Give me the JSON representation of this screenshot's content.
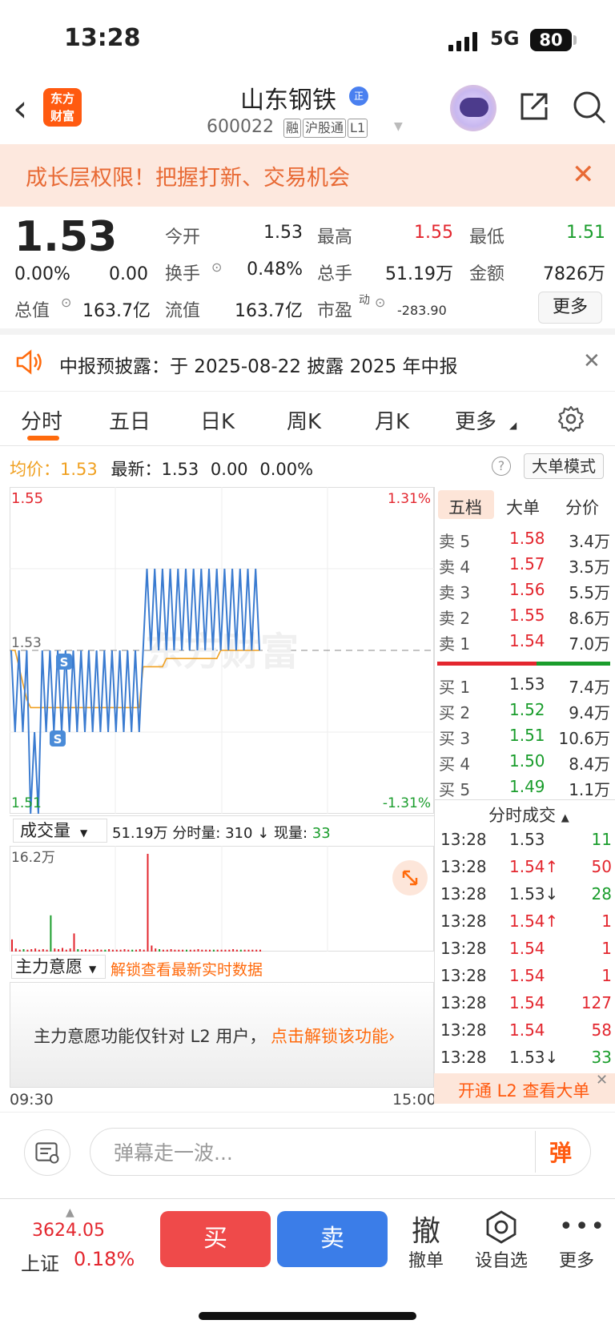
{
  "status_bar": {
    "time": "13:28",
    "network": "5G",
    "battery": "80"
  },
  "header": {
    "logo_text": "东方财富",
    "stock_name": "山东钢铁",
    "badge": "正",
    "stock_code": "600022",
    "tags": [
      "融",
      "沪股通",
      "L1"
    ]
  },
  "promo": {
    "text": "成长层权限！把握打新、交易机会"
  },
  "quote": {
    "price": "1.53",
    "change_pct": "0.00%",
    "change_val": "0.00",
    "open_label": "今开",
    "open": "1.53",
    "high_label": "最高",
    "high": "1.55",
    "low_label": "最低",
    "low": "1.51",
    "turnover_label": "换手",
    "turnover": "0.48%",
    "volume_label": "总手",
    "volume": "51.19万",
    "amount_label": "金额",
    "amount": "7826万",
    "mktcap_label": "总值",
    "mktcap": "163.7亿",
    "float_label": "流值",
    "float": "163.7亿",
    "pe_label": "市盈",
    "pe_sup": "动",
    "pe": "-283.90",
    "more": "更多"
  },
  "notice": {
    "text": "中报预披露：于 2025-08-22 披露 2025 年中报"
  },
  "tabs": [
    "分时",
    "五日",
    "日K",
    "周K",
    "月K",
    "更多"
  ],
  "chart_info": {
    "avg_label": "均价：",
    "avg": "1.53",
    "latest_label": "最新：",
    "latest": "1.53",
    "chg": "0.00",
    "pct": "0.00%",
    "big_mode": "大单模式"
  },
  "chart_data": {
    "type": "line",
    "y_labels": {
      "top_price": "1.55",
      "mid_price": "1.53",
      "bottom_price": "1.51",
      "top_pct": "1.31%",
      "bottom_pct": "-1.31%"
    },
    "ylim": [
      1.51,
      1.55
    ],
    "x_start": "09:30",
    "x_end": "15:00",
    "watermark": "东方财富",
    "series": [
      {
        "name": "最新",
        "values": [
          1.53,
          1.52,
          1.53,
          1.52,
          1.53,
          1.51,
          1.52,
          1.51,
          1.53,
          1.52,
          1.53,
          1.52,
          1.53,
          1.52,
          1.53,
          1.52,
          1.53,
          1.52,
          1.53,
          1.52,
          1.53,
          1.52,
          1.53,
          1.52,
          1.53,
          1.52,
          1.53,
          1.52,
          1.53,
          1.52,
          1.53,
          1.52,
          1.53,
          1.52,
          1.53,
          1.54,
          1.53,
          1.54,
          1.53,
          1.54,
          1.53,
          1.54,
          1.53,
          1.54,
          1.53,
          1.54,
          1.53,
          1.54,
          1.53,
          1.54,
          1.53,
          1.54,
          1.53,
          1.54,
          1.53,
          1.54,
          1.53,
          1.54,
          1.53,
          1.54,
          1.53,
          1.54,
          1.53,
          1.54,
          1.53
        ]
      },
      {
        "name": "均价",
        "values": [
          1.53,
          1.53,
          1.528,
          1.526,
          1.524,
          1.523,
          1.523,
          1.523,
          1.523,
          1.523,
          1.523,
          1.523,
          1.523,
          1.523,
          1.523,
          1.523,
          1.523,
          1.523,
          1.523,
          1.523,
          1.523,
          1.523,
          1.523,
          1.523,
          1.523,
          1.523,
          1.523,
          1.523,
          1.523,
          1.523,
          1.523,
          1.523,
          1.523,
          1.523,
          1.528,
          1.528,
          1.528,
          1.528,
          1.528,
          1.528,
          1.529,
          1.529,
          1.529,
          1.529,
          1.529,
          1.529,
          1.529,
          1.529,
          1.529,
          1.529,
          1.529,
          1.529,
          1.529,
          1.529,
          1.53,
          1.53,
          1.53,
          1.53,
          1.53,
          1.53,
          1.53,
          1.53,
          1.53,
          1.53,
          1.53
        ]
      }
    ],
    "markers": [
      "S",
      "S"
    ],
    "volume": {
      "max_label": "16.2万",
      "values": [
        2,
        0.5,
        0.3,
        0.4,
        0.3,
        0.4,
        0.5,
        0.3,
        0.4,
        0.3,
        6,
        0.5,
        0.4,
        0.6,
        0.3,
        0.5,
        3,
        0.4,
        0.3,
        0.4,
        0.3,
        0.3,
        0.4,
        0.3,
        0.3,
        0.4,
        0.3,
        0.3,
        0.3,
        0.4,
        0.3,
        0.3,
        0.3,
        0.4,
        0.3,
        16.2,
        1,
        0.5,
        0.4,
        0.3,
        0.3,
        0.4,
        0.3,
        0.3,
        0.3,
        0.3,
        0.3,
        0.3,
        0.4,
        0.3,
        0.3,
        0.3,
        0.3,
        0.3,
        0.3,
        0.3,
        0.3,
        0.4,
        0.3,
        0.3,
        0.3,
        0.3,
        0.3,
        0.3,
        0.3
      ]
    }
  },
  "volume_bar": {
    "select": "成交量",
    "total": "51.19万",
    "period_label": "分时量:",
    "period": "310",
    "now_label": "现量:",
    "now": "33"
  },
  "main_force": {
    "select": "主力意愿",
    "unlock": "解锁查看最新实时数据",
    "panel_text": "主力意愿功能仅针对 L2 用户，",
    "panel_link": "点击解锁该功能"
  },
  "order_book": {
    "tabs": [
      "五档",
      "大单",
      "分价"
    ],
    "asks": [
      {
        "label": "卖 5",
        "price": "1.58",
        "vol": "3.4万"
      },
      {
        "label": "卖 4",
        "price": "1.57",
        "vol": "3.5万"
      },
      {
        "label": "卖 3",
        "price": "1.56",
        "vol": "5.5万"
      },
      {
        "label": "卖 2",
        "price": "1.55",
        "vol": "8.6万"
      },
      {
        "label": "卖 1",
        "price": "1.54",
        "vol": "7.0万"
      }
    ],
    "bids": [
      {
        "label": "买 1",
        "price": "1.53",
        "vol": "7.4万"
      },
      {
        "label": "买 2",
        "price": "1.52",
        "vol": "9.4万"
      },
      {
        "label": "买 3",
        "price": "1.51",
        "vol": "10.6万"
      },
      {
        "label": "买 4",
        "price": "1.50",
        "vol": "8.4万"
      },
      {
        "label": "买 5",
        "price": "1.49",
        "vol": "1.1万"
      }
    ],
    "trades_title": "分时成交",
    "trades": [
      {
        "time": "13:28",
        "price": "1.53",
        "vol": "11"
      },
      {
        "time": "13:28",
        "price": "1.54↑",
        "vol": "50"
      },
      {
        "time": "13:28",
        "price": "1.53↓",
        "vol": "28"
      },
      {
        "time": "13:28",
        "price": "1.54↑",
        "vol": "1"
      },
      {
        "time": "13:28",
        "price": "1.54",
        "vol": "1"
      },
      {
        "time": "13:28",
        "price": "1.54",
        "vol": "1"
      },
      {
        "time": "13:28",
        "price": "1.54",
        "vol": "127"
      },
      {
        "time": "13:28",
        "price": "1.54",
        "vol": "58"
      },
      {
        "time": "13:28",
        "price": "1.53↓",
        "vol": "33"
      }
    ],
    "l2_banner": "开通 L2 查看大单"
  },
  "comment": {
    "placeholder": "弹幕走一波...",
    "dan": "弹"
  },
  "bottom": {
    "index_value": "3624.05",
    "index_name": "上证",
    "index_pct": "0.18%",
    "buy": "买",
    "sell": "卖",
    "cancel_icon": "撤",
    "cancel": "撤单",
    "watch": "设自选",
    "more": "更多"
  }
}
